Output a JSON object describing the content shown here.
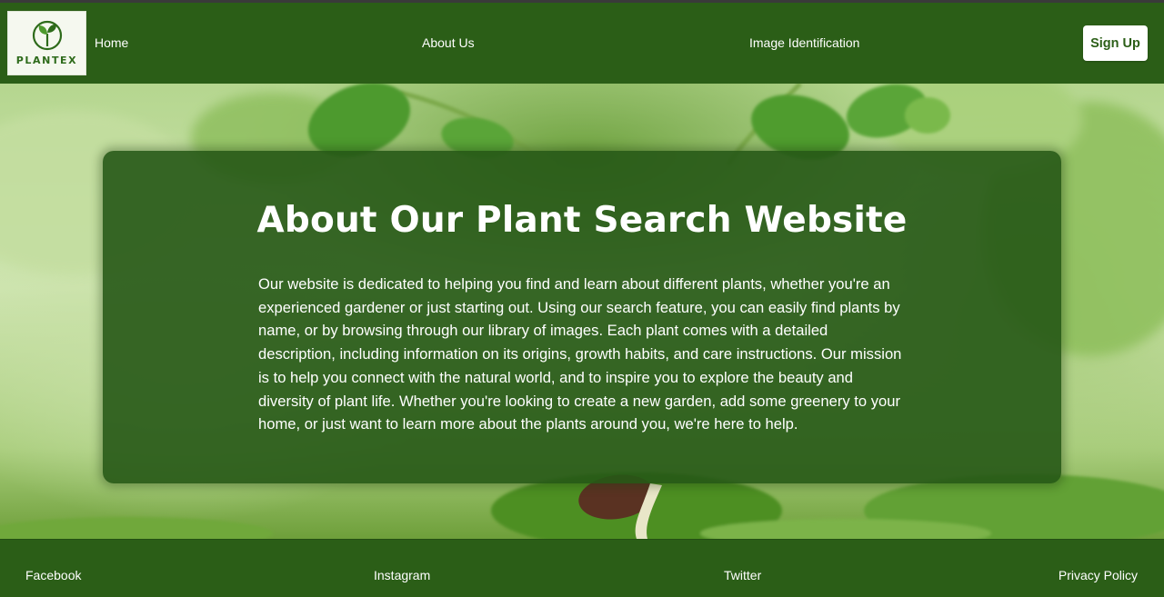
{
  "brand": {
    "logo_text": "PLANTEX",
    "logo_icon": "sprout-icon",
    "primary_color": "#2b5e17",
    "logo_bg": "#f5f8ef"
  },
  "navbar": {
    "home": "Home",
    "about": "About Us",
    "image_identification": "Image Identification",
    "signup": "Sign Up"
  },
  "hero": {
    "title": "About Our Plant Search Website",
    "body": "Our website is dedicated to helping you find and learn about different plants, whether you're an experienced gardener or just starting out. Using our search feature, you can easily find plants by name, or by browsing through our library of images. Each plant comes with a detailed description, including information on its origins, growth habits, and care instructions. Our mission is to help you connect with the natural world, and to inspire you to explore the beauty and diversity of plant life. Whether you're looking to create a new garden, add some greenery to your home, or just want to learn more about the plants around you, we're here to help."
  },
  "footer": {
    "facebook": "Facebook",
    "instagram": "Instagram",
    "twitter": "Twitter",
    "privacy": "Privacy Policy"
  }
}
